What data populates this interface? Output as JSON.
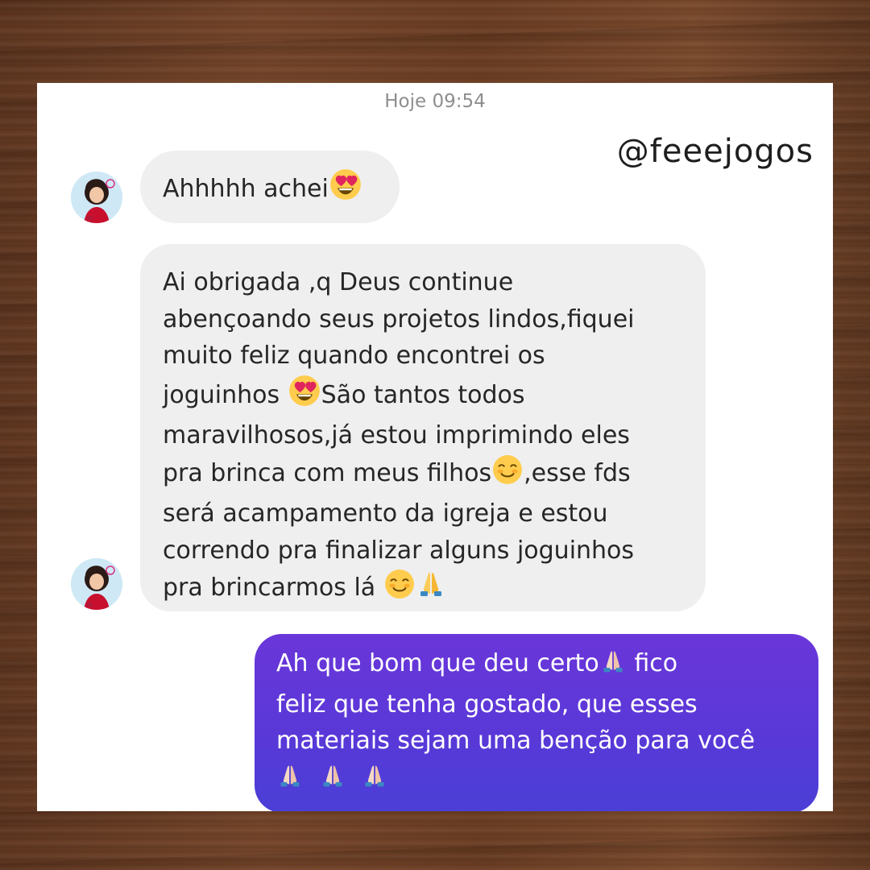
{
  "timestamp": "Hoje 09:54",
  "handle": "@feeejogos",
  "messages": [
    {
      "direction": "incoming",
      "lines": [
        "Ahhhhh achei"
      ]
    },
    {
      "direction": "incoming",
      "lines": [
        "Ai obrigada ,q Deus continue",
        "abençoando seus projetos lindos,fiquei",
        "muito feliz quando encontrei os",
        "joguinhos ",
        "São tantos  todos",
        "maravilhosos,já estou imprimindo eles",
        "pra brinca com meus filhos",
        ",esse fds",
        "será acampamento da igreja e estou",
        "correndo pra finalizar alguns joguinhos",
        "pra brincarmos lá "
      ]
    },
    {
      "direction": "outgoing",
      "lines": [
        "Ah que bom que deu certo",
        " fico",
        "feliz que tenha gostado, que esses",
        "materiais sejam uma benção para você"
      ]
    }
  ],
  "icons": {
    "heart_eyes": "heart-eyes-emoji",
    "smiling": "smiling-emoji",
    "praying": "praying-hands-emoji"
  },
  "colors": {
    "incoming_bubble": "#efefef",
    "outgoing_bubble_top": "#6a36d9",
    "outgoing_bubble_bottom": "#4a3fd6"
  }
}
